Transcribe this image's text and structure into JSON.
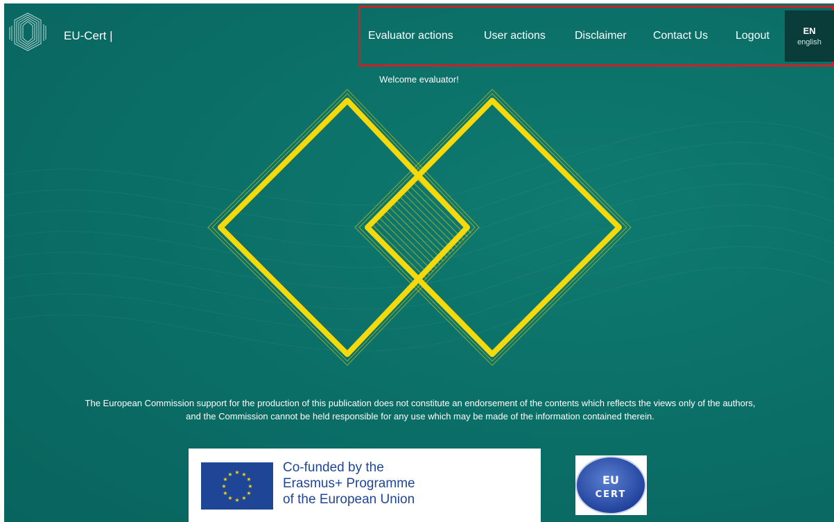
{
  "header": {
    "brand": "EU-Cert |",
    "nav": [
      {
        "label": "Evaluator actions"
      },
      {
        "label": "User actions"
      },
      {
        "label": "Disclaimer"
      },
      {
        "label": "Contact Us"
      },
      {
        "label": "Logout"
      }
    ],
    "language": {
      "code": "EN",
      "name": "english"
    }
  },
  "main": {
    "welcome": "Welcome evaluator!",
    "disclaimer": "The European Commission support for the production of this publication does not constitute an endorsement of the contents which reflects the views only of the authors, and the Commission cannot be held responsible for any use which may be made of the information contained therein."
  },
  "footer": {
    "erasmus_lines": [
      "Co-funded by the",
      "Erasmus+ Programme",
      "of the European Union"
    ],
    "badge_top": "EU",
    "badge_bottom": "CERT"
  },
  "colors": {
    "background": "#0b7068",
    "accent_yellow": "#f5d90a",
    "highlight_border": "#d21f26",
    "lang_button": "#0a3d3a",
    "eu_blue": "#1f4596"
  },
  "icons": {
    "logo": "eu-cert-logo-icon",
    "diamonds": "interlocking-diamonds-icon",
    "flag": "eu-flag-icon"
  }
}
